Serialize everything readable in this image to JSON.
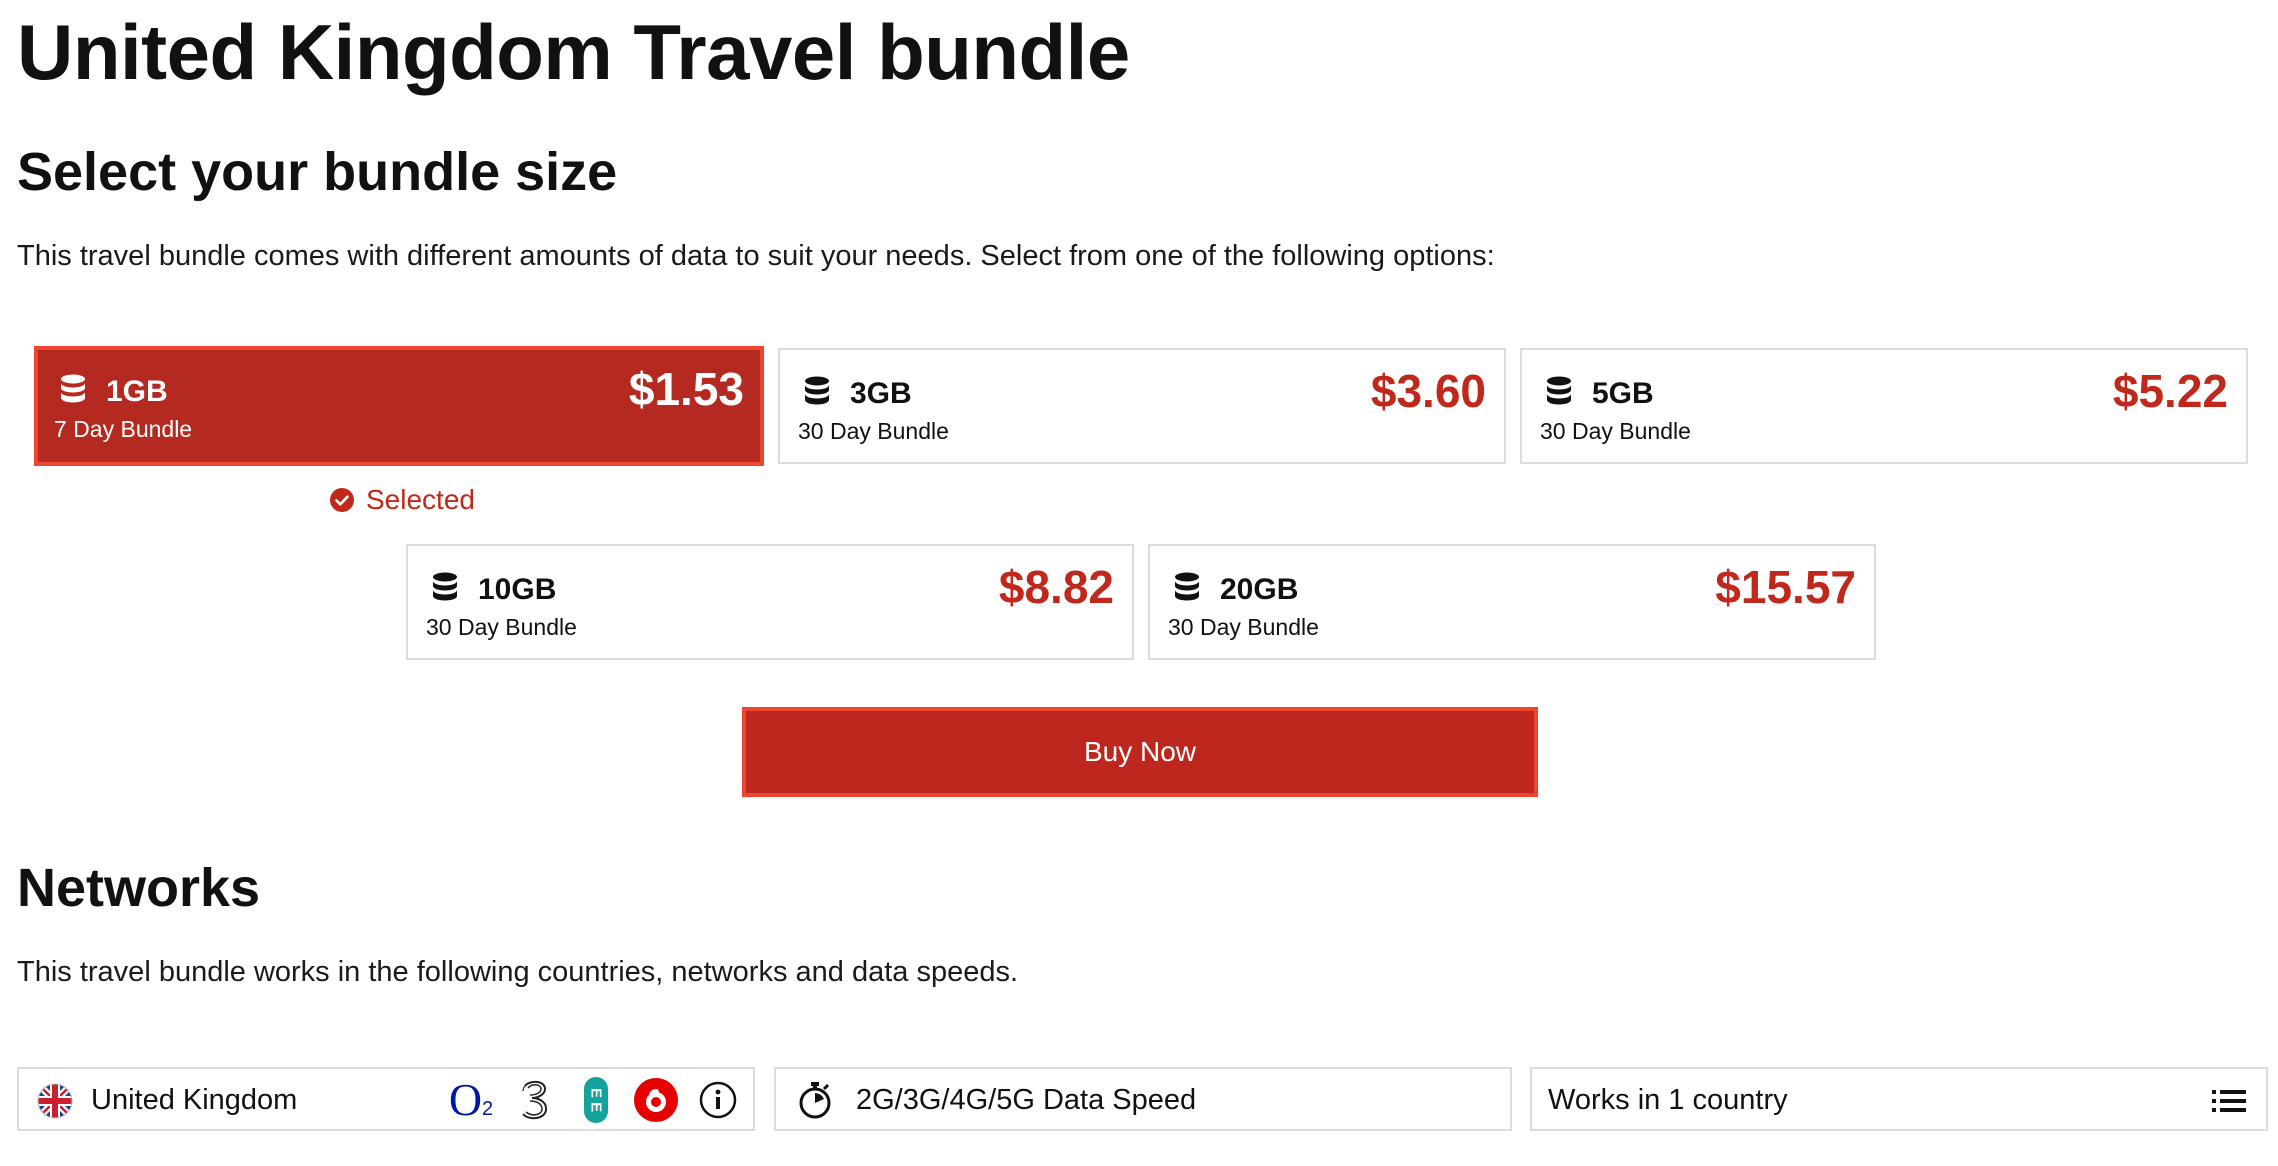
{
  "page": {
    "title": "United Kingdom Travel bundle"
  },
  "bundle_section": {
    "title": "Select your bundle size",
    "description": "This travel bundle comes with different amounts of data to suit your needs. Select from one of the following options:",
    "selected_label": "Selected",
    "bundles": [
      {
        "size": "1GB",
        "duration": "7 Day Bundle",
        "price": "$1.53",
        "selected": true
      },
      {
        "size": "3GB",
        "duration": "30 Day Bundle",
        "price": "$3.60",
        "selected": false
      },
      {
        "size": "5GB",
        "duration": "30 Day Bundle",
        "price": "$5.22",
        "selected": false
      },
      {
        "size": "10GB",
        "duration": "30 Day Bundle",
        "price": "$8.82",
        "selected": false
      },
      {
        "size": "20GB",
        "duration": "30 Day Bundle",
        "price": "$15.57",
        "selected": false
      }
    ],
    "buy_label": "Buy Now"
  },
  "networks_section": {
    "title": "Networks",
    "description": "This travel bundle works in the following countries, networks and data speeds.",
    "country": "United Kingdom",
    "network_logos": [
      "o2-logo",
      "three-logo",
      "ee-logo",
      "vodafone-logo"
    ],
    "o2_text": "O",
    "o2_sub": "2",
    "ee_text": "E E",
    "speed": "2G/3G/4G/5G Data Speed",
    "coverage": "Works in 1 country"
  },
  "colors": {
    "accent": "#bd271d",
    "accent_border": "#ee4530",
    "price": "#c0281c",
    "border": "#dcdcdc"
  }
}
